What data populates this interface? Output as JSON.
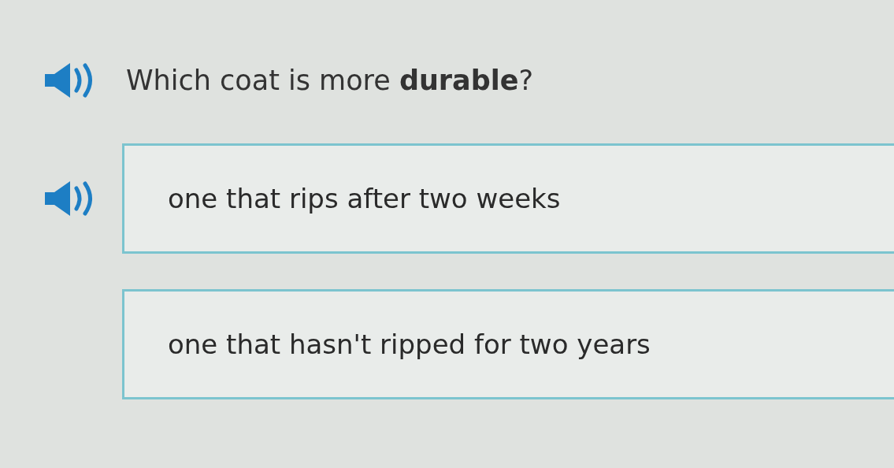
{
  "question": {
    "text": "Which coat is more **durable**?",
    "audio": true
  },
  "options": [
    {
      "text": "one that rips after two weeks",
      "audio": true
    },
    {
      "text": "one that hasn't ripped for two years",
      "audio": false
    }
  ]
}
